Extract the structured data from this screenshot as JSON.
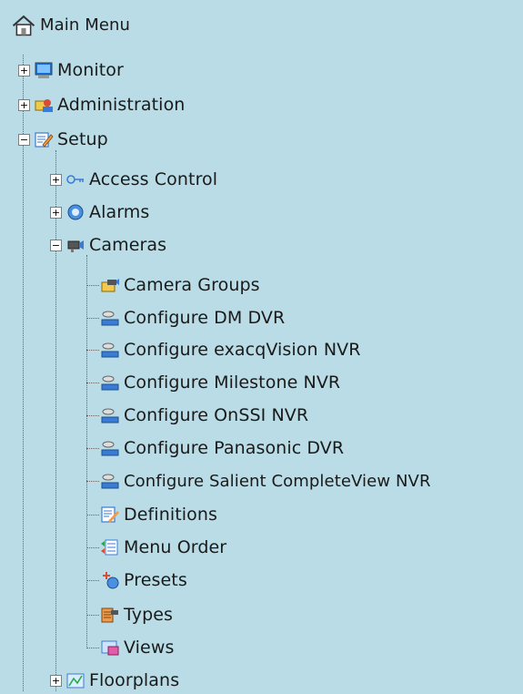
{
  "menu_title": "Main Menu",
  "tree": {
    "monitor": "Monitor",
    "administration": "Administration",
    "setup": "Setup",
    "access_control": "Access Control",
    "alarms": "Alarms",
    "cameras": "Cameras",
    "camera_groups": "Camera Groups",
    "configure_dm_dvr": "Configure DM DVR",
    "configure_exacqvision_nvr": "Configure exacqVision NVR",
    "configure_milestone_nvr": "Configure Milestone NVR",
    "configure_onssi_nvr": "Configure OnSSI NVR",
    "configure_panasonic_dvr": "Configure Panasonic DVR",
    "configure_salient_nvr": "Configure Salient CompleteView NVR",
    "definitions": "Definitions",
    "menu_order": "Menu Order",
    "presets": "Presets",
    "types": "Types",
    "views": "Views",
    "floorplans": "Floorplans"
  },
  "expanders": {
    "plus": "+",
    "minus": "−"
  }
}
